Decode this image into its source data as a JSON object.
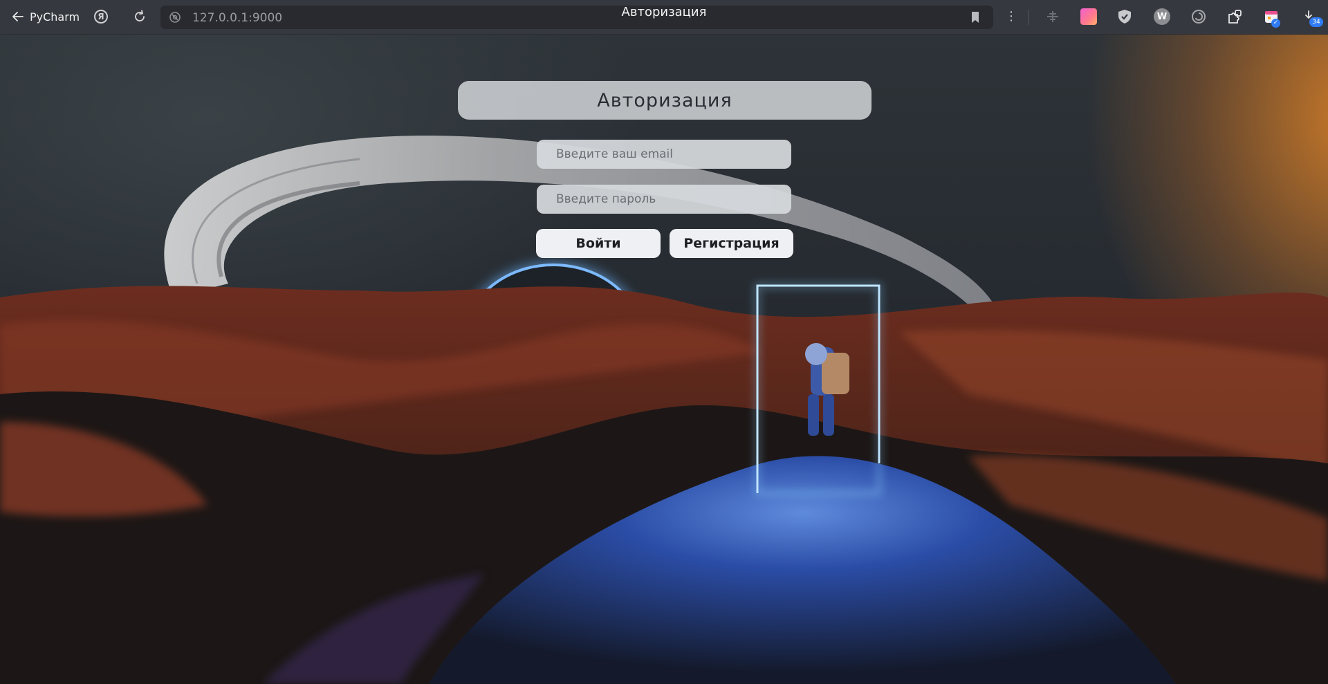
{
  "browser": {
    "back_label": "PyCharm",
    "yandex_icon_glyph": "Я",
    "url": "127.0.0.1:9000",
    "tab_title": "Авторизация",
    "extension_w_label": "W",
    "extension_badge_count": "34"
  },
  "auth": {
    "title": "Авторизация",
    "email_placeholder": "Введите ваш email",
    "password_placeholder": "Введите пароль",
    "login_button": "Войти",
    "register_button": "Регистрация"
  },
  "colors": {
    "chrome_bg": "#36383f",
    "portal_glow": "#59b8ff",
    "dune_orange": "#a9452a",
    "dune_blue": "#2a4ca6",
    "sky_orange": "#d27d28"
  },
  "icons": {
    "back": "arrow-left-icon",
    "reload": "reload-icon",
    "site": "site-info-icon",
    "bookmark": "bookmark-icon",
    "menu": "kebab-menu-icon"
  }
}
